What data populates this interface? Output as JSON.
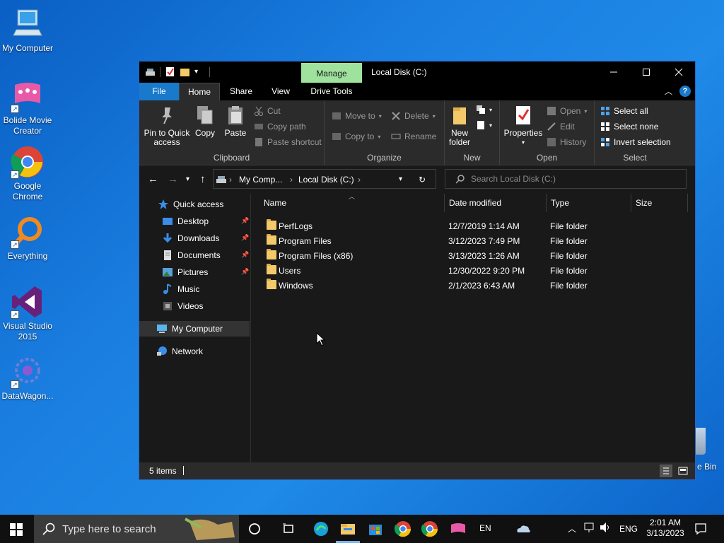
{
  "desktop": {
    "icons": [
      {
        "label": "My Computer"
      },
      {
        "label": "Bolide Movie Creator"
      },
      {
        "label": "Google Chrome"
      },
      {
        "label": "Everything"
      },
      {
        "label": "Visual Studio 2015"
      },
      {
        "label": "DataWagon..."
      }
    ],
    "recycle_partial_label": "e Bin"
  },
  "window": {
    "title": "Local Disk (C:)",
    "manage_tab": "Manage",
    "tabs": {
      "file": "File",
      "home": "Home",
      "share": "Share",
      "view": "View",
      "drive_tools": "Drive Tools"
    },
    "ribbon": {
      "clipboard": {
        "label": "Clipboard",
        "pin": "Pin to Quick access",
        "copy": "Copy",
        "paste": "Paste",
        "cut": "Cut",
        "copy_path": "Copy path",
        "paste_shortcut": "Paste shortcut"
      },
      "organize": {
        "label": "Organize",
        "move_to": "Move to",
        "copy_to": "Copy to",
        "delete": "Delete",
        "rename": "Rename"
      },
      "new": {
        "label": "New",
        "new_folder": "New folder"
      },
      "open": {
        "label": "Open",
        "properties": "Properties",
        "open": "Open",
        "edit": "Edit",
        "history": "History"
      },
      "select": {
        "label": "Select",
        "select_all": "Select all",
        "select_none": "Select none",
        "invert": "Invert selection"
      }
    },
    "address": {
      "crumbs": [
        "My Comp...",
        "Local Disk (C:)"
      ],
      "search_placeholder": "Search Local Disk (C:)"
    },
    "nav": {
      "quick_access": "Quick access",
      "items": [
        "Desktop",
        "Downloads",
        "Documents",
        "Pictures",
        "Music",
        "Videos"
      ],
      "my_computer": "My Computer",
      "network": "Network"
    },
    "columns": {
      "name": "Name",
      "date": "Date modified",
      "type": "Type",
      "size": "Size"
    },
    "rows": [
      {
        "name": "PerfLogs",
        "date": "12/7/2019 1:14 AM",
        "type": "File folder"
      },
      {
        "name": "Program Files",
        "date": "3/12/2023 7:49 PM",
        "type": "File folder"
      },
      {
        "name": "Program Files (x86)",
        "date": "3/13/2023 1:26 AM",
        "type": "File folder"
      },
      {
        "name": "Users",
        "date": "12/30/2022 9:20 PM",
        "type": "File folder"
      },
      {
        "name": "Windows",
        "date": "2/1/2023 6:43 AM",
        "type": "File folder"
      }
    ],
    "status": "5 items"
  },
  "taskbar": {
    "search_text": "Type here to search",
    "lang_short": "EN",
    "lang": "ENG",
    "time": "2:01 AM",
    "date": "3/13/2023"
  },
  "colors": {
    "accent": "#1979ca",
    "manage": "#9ee29e",
    "folder": "#f3c969"
  }
}
